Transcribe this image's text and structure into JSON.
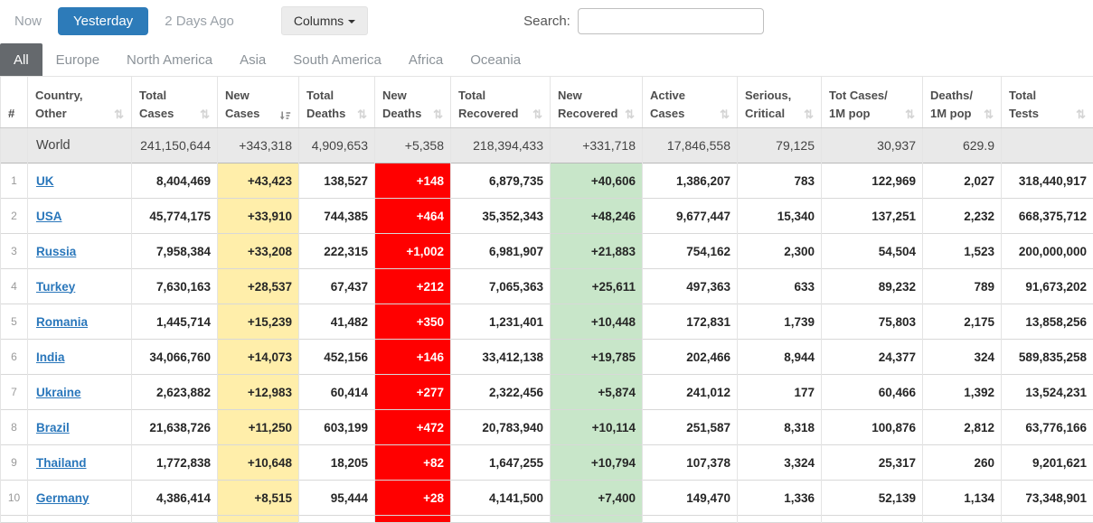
{
  "colors": {
    "accent_blue": "#2d7bb9",
    "tab_active_gray": "#65696d",
    "link_blue": "#2a77bb",
    "new_cases_yellow": "#ffeeaa",
    "new_deaths_red": "#ff0000",
    "new_recovered_green": "#c8e6c9"
  },
  "toolbar": {
    "now_label": "Now",
    "yesterday_label": "Yesterday",
    "two_days_ago_label": "2 Days Ago",
    "columns_label": "Columns",
    "search_label": "Search:",
    "search_value": ""
  },
  "tabs": [
    {
      "label": "All",
      "active": true
    },
    {
      "label": "Europe",
      "active": false
    },
    {
      "label": "North America",
      "active": false
    },
    {
      "label": "Asia",
      "active": false
    },
    {
      "label": "South America",
      "active": false
    },
    {
      "label": "Africa",
      "active": false
    },
    {
      "label": "Oceania",
      "active": false
    }
  ],
  "table": {
    "columns": [
      {
        "key": "rank",
        "line1": "",
        "line2": "#",
        "sortable": false,
        "sort": "none"
      },
      {
        "key": "country",
        "line1": "Country,",
        "line2": "Other",
        "sortable": true,
        "sort": "none"
      },
      {
        "key": "total_cases",
        "line1": "Total",
        "line2": "Cases",
        "sortable": true,
        "sort": "none"
      },
      {
        "key": "new_cases",
        "line1": "New",
        "line2": "Cases",
        "sortable": true,
        "sort": "desc"
      },
      {
        "key": "total_deaths",
        "line1": "Total",
        "line2": "Deaths",
        "sortable": true,
        "sort": "none"
      },
      {
        "key": "new_deaths",
        "line1": "New",
        "line2": "Deaths",
        "sortable": true,
        "sort": "none"
      },
      {
        "key": "total_recovered",
        "line1": "Total",
        "line2": "Recovered",
        "sortable": true,
        "sort": "none"
      },
      {
        "key": "new_recovered",
        "line1": "New",
        "line2": "Recovered",
        "sortable": true,
        "sort": "none"
      },
      {
        "key": "active_cases",
        "line1": "Active",
        "line2": "Cases",
        "sortable": true,
        "sort": "none"
      },
      {
        "key": "serious_critical",
        "line1": "Serious,",
        "line2": "Critical",
        "sortable": true,
        "sort": "none"
      },
      {
        "key": "tot_cases_1m",
        "line1": "Tot Cases/",
        "line2": "1M pop",
        "sortable": true,
        "sort": "none"
      },
      {
        "key": "deaths_1m",
        "line1": "Deaths/",
        "line2": "1M pop",
        "sortable": true,
        "sort": "none"
      },
      {
        "key": "total_tests",
        "line1": "Total",
        "line2": "Tests",
        "sortable": true,
        "sort": "none"
      }
    ],
    "world_row": {
      "name": "World",
      "values": [
        "241,150,644",
        "+343,318",
        "4,909,653",
        "+5,358",
        "218,394,433",
        "+331,718",
        "17,846,558",
        "79,125",
        "30,937",
        "629.9",
        ""
      ]
    },
    "rows": [
      {
        "rank": "1",
        "country": "UK",
        "values": [
          "8,404,469",
          "+43,423",
          "138,527",
          "+148",
          "6,879,735",
          "+40,606",
          "1,386,207",
          "783",
          "122,969",
          "2,027",
          "318,440,917"
        ]
      },
      {
        "rank": "2",
        "country": "USA",
        "values": [
          "45,774,175",
          "+33,910",
          "744,385",
          "+464",
          "35,352,343",
          "+48,246",
          "9,677,447",
          "15,340",
          "137,251",
          "2,232",
          "668,375,712"
        ]
      },
      {
        "rank": "3",
        "country": "Russia",
        "values": [
          "7,958,384",
          "+33,208",
          "222,315",
          "+1,002",
          "6,981,907",
          "+21,883",
          "754,162",
          "2,300",
          "54,504",
          "1,523",
          "200,000,000"
        ]
      },
      {
        "rank": "4",
        "country": "Turkey",
        "values": [
          "7,630,163",
          "+28,537",
          "67,437",
          "+212",
          "7,065,363",
          "+25,611",
          "497,363",
          "633",
          "89,232",
          "789",
          "91,673,202"
        ]
      },
      {
        "rank": "5",
        "country": "Romania",
        "values": [
          "1,445,714",
          "+15,239",
          "41,482",
          "+350",
          "1,231,401",
          "+10,448",
          "172,831",
          "1,739",
          "75,803",
          "2,175",
          "13,858,256"
        ]
      },
      {
        "rank": "6",
        "country": "India",
        "values": [
          "34,066,760",
          "+14,073",
          "452,156",
          "+146",
          "33,412,138",
          "+19,785",
          "202,466",
          "8,944",
          "24,377",
          "324",
          "589,835,258"
        ]
      },
      {
        "rank": "7",
        "country": "Ukraine",
        "values": [
          "2,623,882",
          "+12,983",
          "60,414",
          "+277",
          "2,322,456",
          "+5,874",
          "241,012",
          "177",
          "60,466",
          "1,392",
          "13,524,231"
        ]
      },
      {
        "rank": "8",
        "country": "Brazil",
        "values": [
          "21,638,726",
          "+11,250",
          "603,199",
          "+472",
          "20,783,940",
          "+10,114",
          "251,587",
          "8,318",
          "100,876",
          "2,812",
          "63,776,166"
        ]
      },
      {
        "rank": "9",
        "country": "Thailand",
        "values": [
          "1,772,838",
          "+10,648",
          "18,205",
          "+82",
          "1,647,255",
          "+10,794",
          "107,378",
          "3,324",
          "25,317",
          "260",
          "9,201,621"
        ]
      },
      {
        "rank": "10",
        "country": "Germany",
        "values": [
          "4,386,414",
          "+8,515",
          "95,444",
          "+28",
          "4,141,500",
          "+7,400",
          "149,470",
          "1,336",
          "52,139",
          "1,134",
          "73,348,901"
        ]
      }
    ]
  }
}
